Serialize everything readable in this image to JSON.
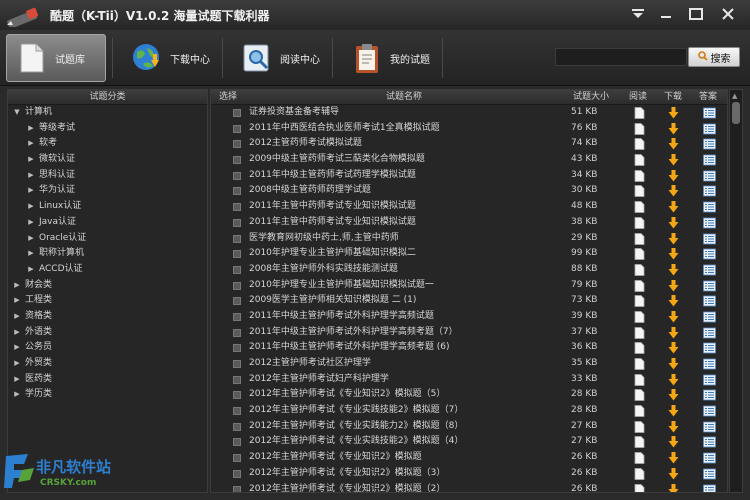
{
  "app": {
    "title": "酷题（K-Tii）V1.0.2 海量试题下载利器"
  },
  "titlebar_buttons": [
    "dropdown-icon",
    "minimize-icon",
    "maximize-icon",
    "close-icon"
  ],
  "toolbar": {
    "items": [
      {
        "label": "试题库",
        "icon": "document-icon",
        "active": true
      },
      {
        "label": "下载中心",
        "icon": "globe-download-icon",
        "active": false
      },
      {
        "label": "阅读中心",
        "icon": "reader-search-icon",
        "active": false
      },
      {
        "label": "我的试题",
        "icon": "clipboard-icon",
        "active": false
      }
    ],
    "search_placeholder": "",
    "search_label": "搜索"
  },
  "left": {
    "header": "试题分类",
    "tree": [
      {
        "label": "计算机",
        "level": 0,
        "expanded": true
      },
      {
        "label": "等级考试",
        "level": 1
      },
      {
        "label": "软考",
        "level": 1
      },
      {
        "label": "微软认证",
        "level": 1
      },
      {
        "label": "思科认证",
        "level": 1
      },
      {
        "label": "华为认证",
        "level": 1
      },
      {
        "label": "Linux认证",
        "level": 1
      },
      {
        "label": "Java认证",
        "level": 1
      },
      {
        "label": "Oracle认证",
        "level": 1
      },
      {
        "label": "职称计算机",
        "level": 1
      },
      {
        "label": "ACCD认证",
        "level": 1
      },
      {
        "label": "财会类",
        "level": 0
      },
      {
        "label": "工程类",
        "level": 0
      },
      {
        "label": "资格类",
        "level": 0
      },
      {
        "label": "外语类",
        "level": 0
      },
      {
        "label": "公务员",
        "level": 0
      },
      {
        "label": "外贸类",
        "level": 0
      },
      {
        "label": "医药类",
        "level": 0
      },
      {
        "label": "学历类",
        "level": 0
      }
    ]
  },
  "table": {
    "headers": {
      "select": "选择",
      "name": "试题名称",
      "size": "试题大小",
      "read": "阅读",
      "download": "下载",
      "answer": "答案"
    },
    "rows": [
      {
        "name": "证券投资基金备考辅导",
        "size": "51 KB"
      },
      {
        "name": "2011年中西医结合执业医师考试1全真模拟试题",
        "size": "76 KB"
      },
      {
        "name": "2012主管药师考试模拟试题",
        "size": "74 KB"
      },
      {
        "name": "2009中级主管药师考试三萜类化合物模拟题",
        "size": "43 KB"
      },
      {
        "name": "2011年中级主管药师考试药理学模拟试题",
        "size": "34 KB"
      },
      {
        "name": "2008中级主管药师药理学试题",
        "size": "30 KB"
      },
      {
        "name": "2011年主管中药师考试专业知识模拟试题",
        "size": "48 KB"
      },
      {
        "name": "2011年主管中药师考试专业知识模拟试题",
        "size": "38 KB"
      },
      {
        "name": "医学教育网初级中药士,师,主管中药师",
        "size": "29 KB"
      },
      {
        "name": "2010年护理专业主管护师基础知识模拟二",
        "size": "99 KB"
      },
      {
        "name": "2008年主管护师外科实践技能测试题",
        "size": "88 KB"
      },
      {
        "name": "2010年护理专业主管护师基础知识模拟试题一",
        "size": "79 KB"
      },
      {
        "name": "2009医学主管护师相关知识模拟题 二 (1)",
        "size": "73 KB"
      },
      {
        "name": "2011年中级主管护师考试外科护理学高频试题",
        "size": "39 KB"
      },
      {
        "name": "2011年中级主管护师考试外科护理学高频考题（7）",
        "size": "37 KB"
      },
      {
        "name": "2011年中级主管护师考试外科护理学高频考题 (6)",
        "size": "36 KB"
      },
      {
        "name": "2012主管护师考试社区护理学",
        "size": "35 KB"
      },
      {
        "name": "2012年主管护师考试妇产科护理学",
        "size": "33 KB"
      },
      {
        "name": "2012年主管护师考试《专业知识2》模拟题（5）",
        "size": "28 KB"
      },
      {
        "name": "2012年主管护师考试《专业实践技能2》模拟题（7）",
        "size": "28 KB"
      },
      {
        "name": "2012年主管护师考试《专业实践能力2》模拟题（8）",
        "size": "27 KB"
      },
      {
        "name": "2012年主管护师考试《专业实践技能2》模拟题（4）",
        "size": "27 KB"
      },
      {
        "name": "2012年主管护师考试《专业知识2》模拟题",
        "size": "26 KB"
      },
      {
        "name": "2012年主管护师考试《专业知识2》模拟题（3）",
        "size": "26 KB"
      },
      {
        "name": "2012年主管护师考试《专业知识2》模拟题（2）",
        "size": "26 KB"
      }
    ]
  },
  "watermark": {
    "cn": "非凡软件站",
    "en": "CRSKY.com"
  }
}
